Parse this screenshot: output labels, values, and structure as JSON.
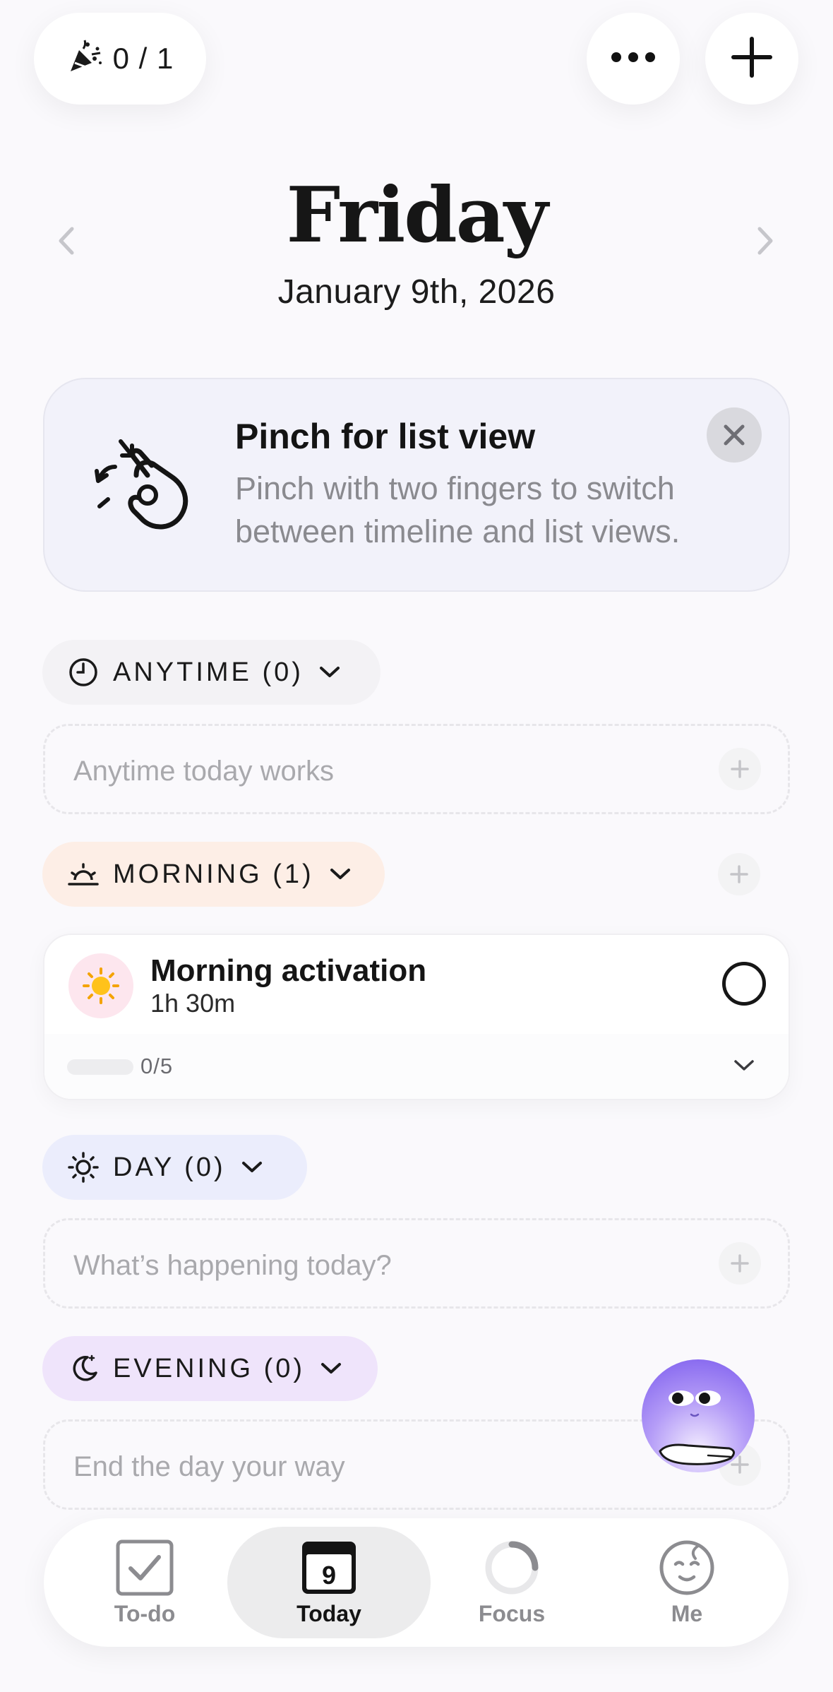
{
  "top_bar": {
    "progress_count": "0 / 1"
  },
  "header": {
    "day": "Friday",
    "date": "January 9th, 2026"
  },
  "tip": {
    "title": "Pinch for list view",
    "body": "Pinch with two fingers to switch between timeline and list views."
  },
  "sections": {
    "anytime": {
      "label": "ANYTIME (0)",
      "placeholder": "Anytime today works",
      "color": "#f3f2f5"
    },
    "morning": {
      "label": "MORNING (1)",
      "color": "#fdeee6"
    },
    "day": {
      "label": "DAY (0)",
      "placeholder": "What’s happening today?",
      "color": "#ebedfc"
    },
    "evening": {
      "label": "EVENING (0)",
      "placeholder": "End the day your way",
      "color": "#efe4fb"
    }
  },
  "task": {
    "title": "Morning activation",
    "duration": "1h 30m",
    "progress_text": "0/5",
    "progress_fraction": 0,
    "icon": "sun-icon"
  },
  "nav": {
    "items": [
      {
        "label": "To-do",
        "icon": "checkbox-icon"
      },
      {
        "label": "Today",
        "icon": "calendar-icon",
        "badge": "9",
        "active": true
      },
      {
        "label": "Focus",
        "icon": "focus-ring-icon"
      },
      {
        "label": "Me",
        "icon": "face-icon"
      }
    ]
  }
}
